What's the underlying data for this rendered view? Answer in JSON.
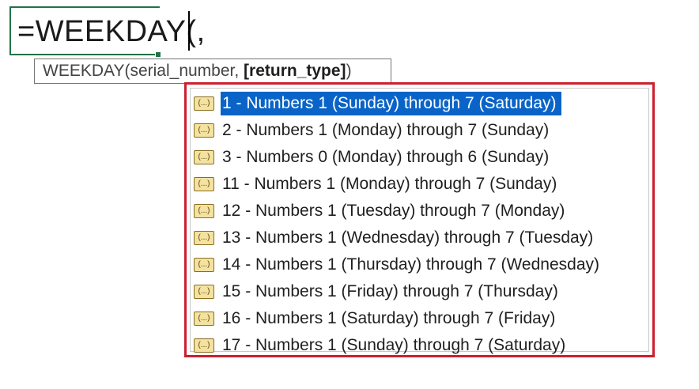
{
  "formula_bar": {
    "text": "=WEEKDAY(,"
  },
  "tooltip": {
    "prefix": "WEEKDAY(serial_number, ",
    "bold_arg": "[return_type]",
    "suffix": ")"
  },
  "return_type_options": [
    {
      "label": "1 - Numbers 1 (Sunday) through 7 (Saturday)",
      "selected": true,
      "icon": "enum-value-icon"
    },
    {
      "label": "2 - Numbers 1 (Monday) through 7 (Sunday)",
      "selected": false,
      "icon": "enum-value-icon"
    },
    {
      "label": "3 - Numbers 0 (Monday) through 6 (Sunday)",
      "selected": false,
      "icon": "enum-value-icon"
    },
    {
      "label": "11 - Numbers 1 (Monday) through 7 (Sunday)",
      "selected": false,
      "icon": "enum-value-icon"
    },
    {
      "label": "12 - Numbers 1 (Tuesday) through 7 (Monday)",
      "selected": false,
      "icon": "enum-value-icon"
    },
    {
      "label": "13 - Numbers 1 (Wednesday) through 7 (Tuesday)",
      "selected": false,
      "icon": "enum-value-icon"
    },
    {
      "label": "14 - Numbers 1 (Thursday) through 7 (Wednesday)",
      "selected": false,
      "icon": "enum-value-icon"
    },
    {
      "label": "15 - Numbers 1 (Friday) through 7 (Thursday)",
      "selected": false,
      "icon": "enum-value-icon"
    },
    {
      "label": "16 - Numbers 1 (Saturday) through 7 (Friday)",
      "selected": false,
      "icon": "enum-value-icon"
    },
    {
      "label": "17 - Numbers 1 (Sunday) through 7 (Saturday)",
      "selected": false,
      "icon": "enum-value-icon"
    }
  ],
  "colors": {
    "highlight_border": "#cc1f2f",
    "selection_bg": "#0a64c8",
    "cell_border": "#217346",
    "icon_fill": "#f4e2a0"
  }
}
